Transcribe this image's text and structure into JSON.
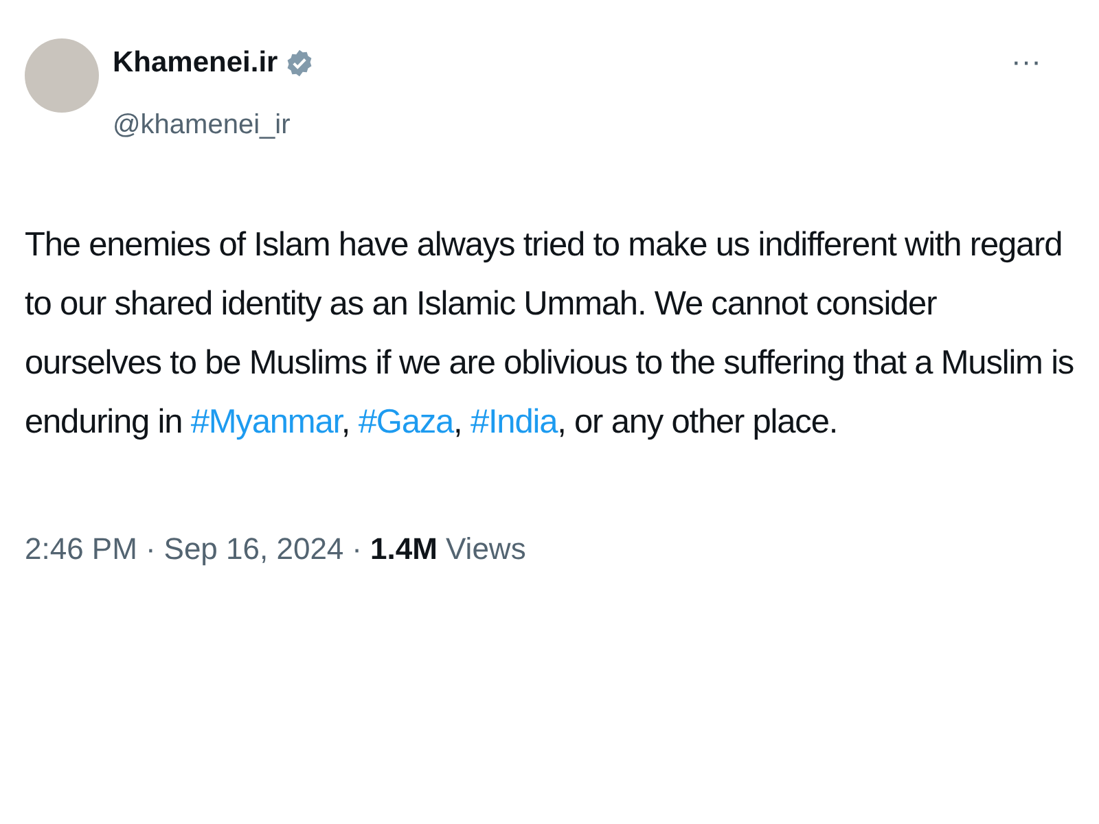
{
  "author": {
    "name": "Khamenei.ir",
    "verified": true,
    "handle": "@khamenei_ir"
  },
  "more_menu": "···",
  "body": [
    {
      "kind": "text",
      "text": "The enemies of Islam have always tried to make us indifferent with regard to our shared identity as an Islamic Ummah. We cannot consider ourselves to be Muslims if we are oblivious to the suffering that a Muslim is enduring in "
    },
    {
      "kind": "hashtag",
      "text": "#Myanmar"
    },
    {
      "kind": "text",
      "text": ", "
    },
    {
      "kind": "hashtag",
      "text": "#Gaza"
    },
    {
      "kind": "text",
      "text": ", "
    },
    {
      "kind": "hashtag",
      "text": "#India"
    },
    {
      "kind": "text",
      "text": ", or any other place."
    }
  ],
  "meta": {
    "time": "2:46 PM",
    "separator_1": "·",
    "date": "Sep 16, 2024",
    "separator_2": "·",
    "views": "**1.4M** Views"
  }
}
